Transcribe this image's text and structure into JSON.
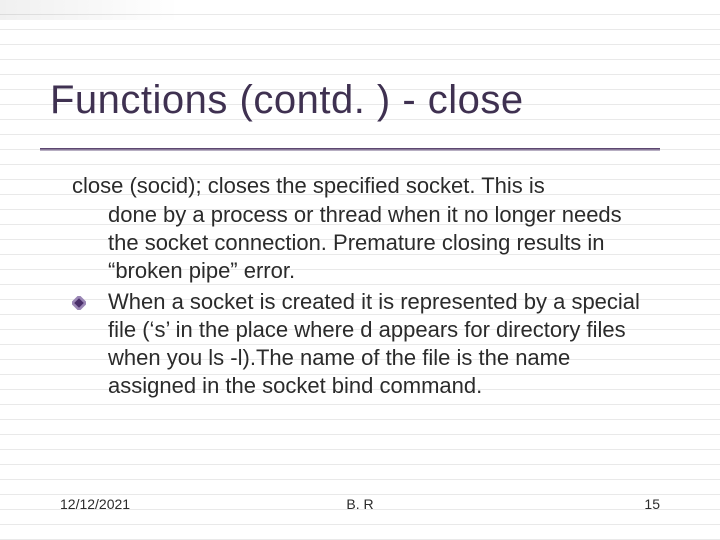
{
  "title": "Functions (contd. ) - close",
  "body": {
    "p1_lead": "close (socid); closes the specified socket. This is",
    "p1_rest": "done by a process or thread when it no longer needs the socket connection. Premature closing results in “broken pipe” error.",
    "p2": "When a socket is created it is represented by a special file (‘s’ in the place where d appears for directory files when you ls -l).The name of the file is the name assigned in the socket bind command."
  },
  "footer": {
    "date": "12/12/2021",
    "author": "B. R",
    "slide_no": "15"
  },
  "icons": {
    "bullet": "diamond-marker-icon"
  },
  "colors": {
    "title": "#3f3151",
    "bullet_outer": "#9a86b5",
    "bullet_inner": "#4a2f6a"
  }
}
